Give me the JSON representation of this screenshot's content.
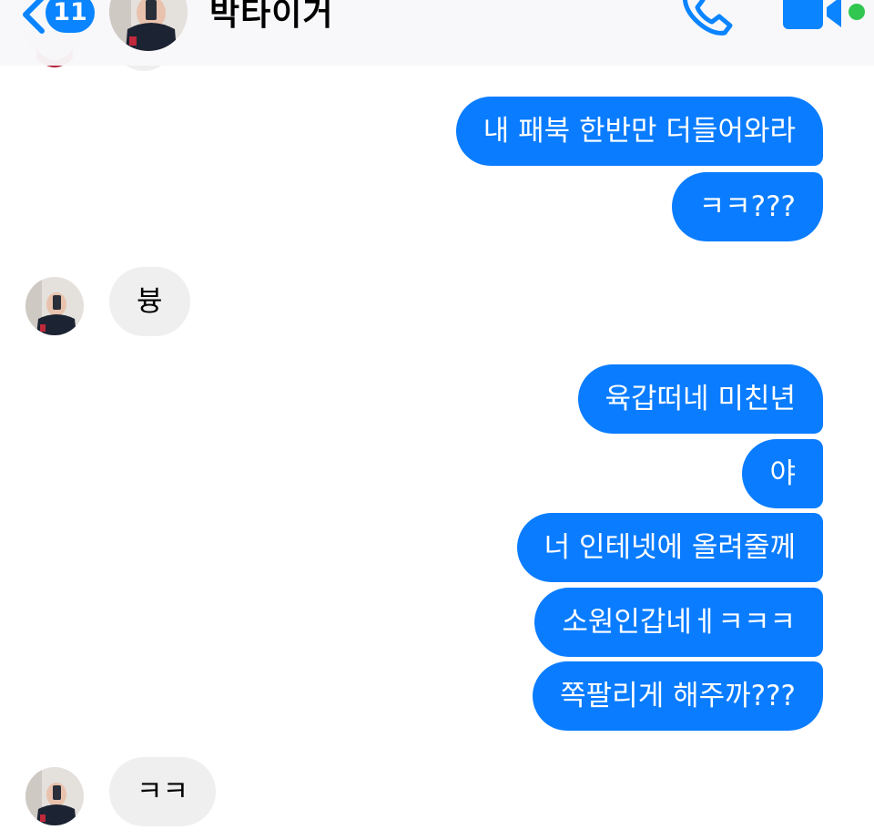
{
  "header": {
    "unread_count": "11",
    "contact_name": "박타이거",
    "icons": [
      "back-chevron-icon",
      "phone-icon",
      "video-camera-icon"
    ],
    "online_color": "#31c650",
    "accent_color": "#0a84ff"
  },
  "messages": [
    {
      "from": "me",
      "text": "내 패북 한반만 더들어와라"
    },
    {
      "from": "me",
      "text": "ㅋㅋ???"
    },
    {
      "from": "them",
      "text": "븅"
    },
    {
      "from": "me",
      "text": "육갑떠네 미친년"
    },
    {
      "from": "me",
      "text": "야"
    },
    {
      "from": "me",
      "text": "너 인테넷에 올려줄께"
    },
    {
      "from": "me",
      "text": "소원인갑네ㅔㅋㅋㅋ"
    },
    {
      "from": "me",
      "text": "쪽팔리게 해주까???"
    },
    {
      "from": "them",
      "text": "ㅋㅋ"
    }
  ],
  "colors": {
    "outgoing_bubble": "#0a7cff",
    "incoming_bubble": "#efefef"
  }
}
